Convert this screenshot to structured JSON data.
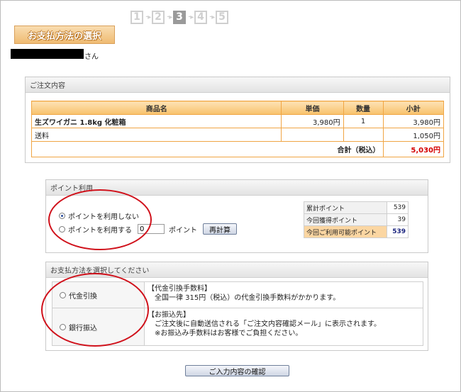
{
  "steps": [
    "1",
    "2",
    "3",
    "4",
    "5"
  ],
  "active_step": 2,
  "title": "お支払方法の選択",
  "user": {
    "suffix": "さん"
  },
  "order": {
    "header": "ご注文内容",
    "columns": [
      "商品名",
      "単価",
      "数量",
      "小計"
    ],
    "item": {
      "name": "生ズワイガニ 1.8kg 化粧箱",
      "price": "3,980円",
      "qty": "1",
      "subtotal": "3,980円"
    },
    "shipping": {
      "label": "送料",
      "amount": "1,050円"
    },
    "total": {
      "label": "合計（税込）",
      "amount": "5,030円"
    }
  },
  "points": {
    "header": "ポイント利用",
    "option_no": "ポイントを利用しない",
    "option_use": "ポイントを利用する",
    "input_value": "0",
    "unit": "ポイント",
    "recalc_label": "再計算",
    "summary": [
      {
        "label": "累計ポイント",
        "value": "539"
      },
      {
        "label": "今回獲得ポイント",
        "value": "39"
      },
      {
        "label": "今回ご利用可能ポイント",
        "value": "539"
      }
    ]
  },
  "payment": {
    "header": "お支払方法を選択してください",
    "cod": {
      "label": "代金引換",
      "title": "【代金引換手数料】",
      "line1": "全国一律 315円（税込）の代金引換手数料がかかります。"
    },
    "bank": {
      "label": "銀行振込",
      "title": "【お振込先】",
      "line1": "ご注文後に自動送信される「ご注文内容確認メール」に表示されます。",
      "line2": "※お振込み手数料はお客様でご負担ください。"
    }
  },
  "confirm_label": "ご入力内容の確認",
  "colors": {
    "accent_orange": "#f0a544",
    "annotation_red": "#d0111b",
    "highlight_total": "#d40000"
  }
}
